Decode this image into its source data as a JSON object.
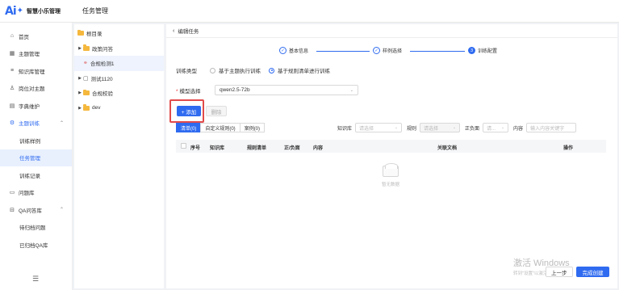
{
  "header": {
    "logo_mark": "Ai",
    "logo_star": "✦",
    "app_name": "智慧小乐管理",
    "page_title": "任务管理"
  },
  "sidebar": {
    "items": [
      {
        "label": "首页",
        "icon": "home-icon"
      },
      {
        "label": "主题管理",
        "icon": "grid-icon"
      },
      {
        "label": "知识库管理",
        "icon": "list-icon"
      },
      {
        "label": "岗位对主题",
        "icon": "user-icon"
      },
      {
        "label": "字典维护",
        "icon": "book-icon"
      },
      {
        "label": "主题训练",
        "icon": "settings-icon",
        "open": true
      },
      {
        "label": "训练样例",
        "sub": true
      },
      {
        "label": "任务管理",
        "sub": true,
        "active": true
      },
      {
        "label": "训练记录",
        "sub": true
      },
      {
        "label": "问题库",
        "icon": "folder-icon"
      },
      {
        "label": "QA问答库",
        "icon": "qa-icon",
        "open": true
      },
      {
        "label": "待归档问题",
        "sub": true
      },
      {
        "label": "已归档QA库",
        "sub": true
      }
    ],
    "collapse_icon": "☰"
  },
  "tree": {
    "nodes": [
      {
        "label": "根目录",
        "type": "folder",
        "level": 0
      },
      {
        "label": "政策问答",
        "type": "folder",
        "level": 1,
        "arrow": true
      },
      {
        "label": "合规检测1",
        "type": "link",
        "level": 1,
        "selected": true
      },
      {
        "label": "测试1120",
        "type": "box",
        "level": 1,
        "arrow": true
      },
      {
        "label": "合规校验",
        "type": "folder",
        "level": 1,
        "arrow": true
      },
      {
        "label": "dev",
        "type": "folder",
        "level": 1,
        "arrow": true
      }
    ]
  },
  "main": {
    "back_label": "编辑任务",
    "steps": [
      {
        "label": "基本信息",
        "mark": "✓"
      },
      {
        "label": "样例选择",
        "mark": "✓"
      },
      {
        "label": "训练配置",
        "mark": "3"
      }
    ],
    "train_type_label": "训练类型",
    "train_type_options": [
      "基于主题执行训练",
      "基于规则清单进行训练"
    ],
    "model_label": "模型选择",
    "model_value": "qwen2.5-72b",
    "add_label": "+ 添加",
    "delete_label": "删除",
    "tabs": [
      "清单(0)",
      "自定义规则(0)",
      "案例(0)"
    ],
    "filters": {
      "kb_label": "知识库",
      "kb_placeholder": "请选择",
      "rule_label": "规则",
      "rule_placeholder": "请选择",
      "pn_label": "正负面",
      "pn_placeholder": "请...",
      "content_label": "内容",
      "content_placeholder": "输入内容关键字"
    },
    "table_headers": [
      "序号",
      "知识库",
      "规则清单",
      "正/负面",
      "内容",
      "关联文档",
      "操作"
    ],
    "empty_text": "暂无数据",
    "prev_label": "上一步",
    "finish_label": "完成创建"
  },
  "watermark": {
    "line1": "激活 Windows",
    "line2": "转到\"设置\"以激活 Windows。"
  },
  "colors": {
    "primary": "#2f6bf0",
    "highlight": "#e24b4b"
  }
}
